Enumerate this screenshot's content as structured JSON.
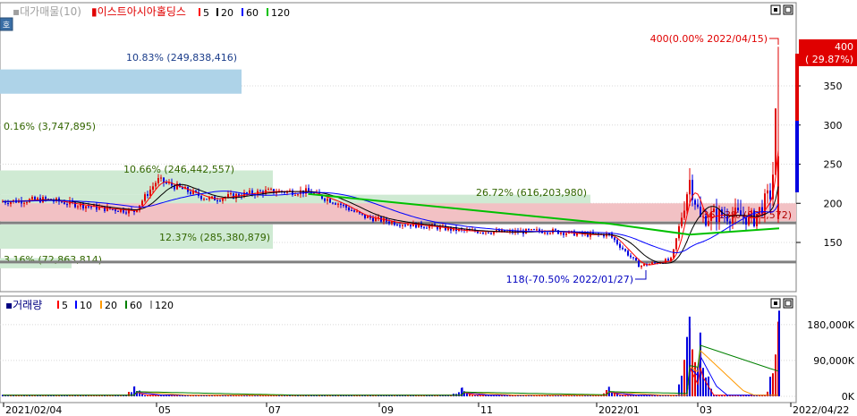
{
  "price_pane": {
    "title_prefix": "▪대가매물(10)",
    "stock_name": "▮이스트아시아홀딩스",
    "ma_legend": [
      {
        "label": "5",
        "color": "#ff0000"
      },
      {
        "label": "20",
        "color": "#000000"
      },
      {
        "label": "60",
        "color": "#0000ff"
      },
      {
        "label": "120",
        "color": "#00c000"
      }
    ],
    "side_button": "호"
  },
  "volume_pane": {
    "title": "▪거래량",
    "ma_legend": [
      {
        "label": "5",
        "color": "#ff0000"
      },
      {
        "label": "10",
        "color": "#0000ff"
      },
      {
        "label": "20",
        "color": "#ff9900"
      },
      {
        "label": "60",
        "color": "#008000"
      },
      {
        "label": "120",
        "color": "#999999"
      }
    ]
  },
  "chart_data": [
    {
      "type": "candlestick",
      "pane": "price",
      "date_range": [
        "2021/02/04",
        "2022/04/22"
      ],
      "ylim": [
        100,
        420
      ],
      "y_ticks": [
        "150",
        "200",
        "250",
        "300",
        "350"
      ],
      "current_price_label": "400",
      "current_change_label": "( 29.87%)",
      "annotations": {
        "high": "400(0.00% 2022/04/15)",
        "low": "118(-70.50% 2022/01/27)"
      },
      "horizontal_lines": [
        {
          "price": 175,
          "color": "#808080"
        },
        {
          "price": 125,
          "color": "#808080"
        }
      ],
      "volume_profile_bands": [
        {
          "label": "10.83% (249,838,416)",
          "price_from": 340,
          "price_to": 371,
          "color": "#aed3e8"
        },
        {
          "label": "0.16% (3,747,895)",
          "price_from": 290,
          "price_to": 320,
          "color": "#cfead3"
        },
        {
          "label": "10.66% (246,442,557)",
          "price_from": 211,
          "price_to": 242,
          "color": "#cfead3"
        },
        {
          "label": "26.72% (616,203,980)",
          "price_from": 180,
          "price_to": 211,
          "color": "#cfead3"
        },
        {
          "label": "36.13% (833,572)",
          "price_from": 177,
          "price_to": 200,
          "color": "#f2c1c4"
        },
        {
          "label": "12.37% (285,380,879)",
          "price_from": 142,
          "price_to": 173,
          "color": "#cfead3"
        },
        {
          "label": "3.16% (72,863,814)",
          "price_from": 117,
          "price_to": 130,
          "color": "#cfead3"
        }
      ],
      "close_series": {
        "dates": [
          "2021/02/04",
          "2021/03/01",
          "2021/04/01",
          "2021/04/20",
          "2021/05/03",
          "2021/06/01",
          "2021/07/01",
          "2021/07/26",
          "2021/08/12",
          "2021/08/26",
          "2021/09/13",
          "2021/10/04",
          "2021/10/20",
          "2021/11/15",
          "2021/12/06",
          "2021/12/28",
          "2022/01/10",
          "2022/01/27",
          "2022/02/14",
          "2022/02/24",
          "2022/03/02",
          "2022/03/10",
          "2022/03/21",
          "2022/04/01",
          "2022/04/11",
          "2022/04/15"
        ],
        "values": [
          202,
          205,
          194,
          190,
          230,
          205,
          215,
          215,
          200,
          183,
          175,
          170,
          165,
          163,
          165,
          160,
          160,
          120,
          128,
          230,
          180,
          185,
          185,
          180,
          215,
          400
        ]
      }
    },
    {
      "type": "bar",
      "pane": "volume",
      "y_ticks": [
        "0K",
        "90,000K",
        "180,000K"
      ],
      "ylim": [
        0,
        220000
      ],
      "x_ticks": [
        "2021/02/04",
        "05",
        "07",
        "09",
        "11",
        "2022/01",
        "03",
        "2022/04/22"
      ],
      "peaks": [
        {
          "date": "2021/04/20",
          "value": 25000
        },
        {
          "date": "2021/10/20",
          "value": 22000
        },
        {
          "date": "2022/01/10",
          "value": 24000
        },
        {
          "date": "2022/02/24",
          "value": 200000
        },
        {
          "date": "2022/03/02",
          "value": 160000
        },
        {
          "date": "2022/04/15",
          "value": 215000
        }
      ]
    }
  ]
}
